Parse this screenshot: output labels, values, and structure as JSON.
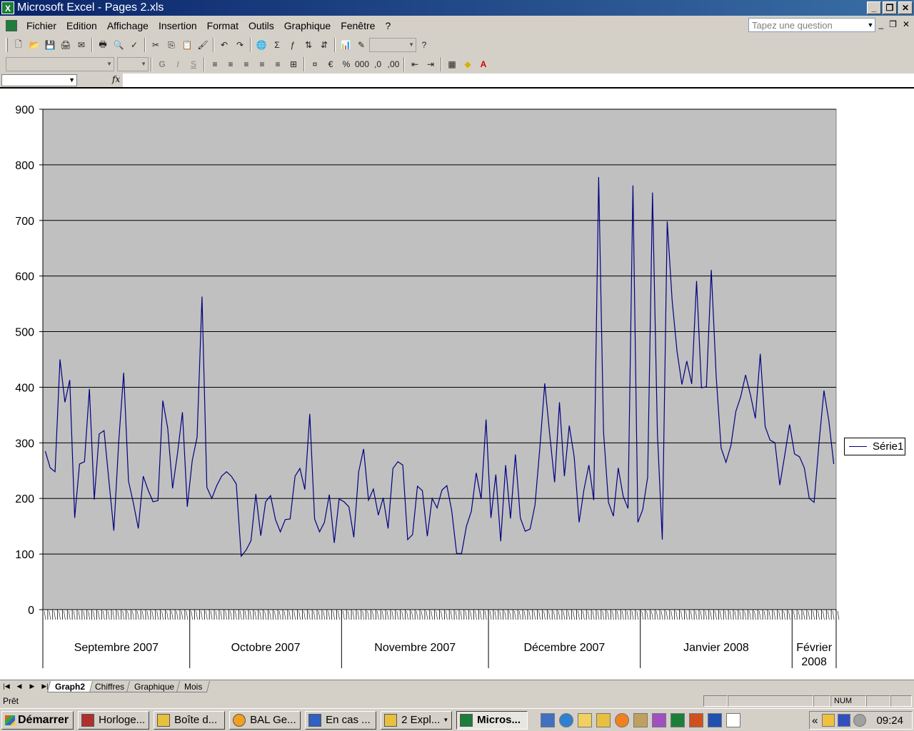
{
  "window": {
    "title": "Microsoft Excel - Pages 2.xls",
    "app_icon": "X"
  },
  "menu": [
    "Fichier",
    "Edition",
    "Affichage",
    "Insertion",
    "Format",
    "Outils",
    "Graphique",
    "Fenêtre",
    "?"
  ],
  "question_box": {
    "placeholder": "Tapez une question"
  },
  "formula": {
    "fx_label": "fx"
  },
  "chart_data": {
    "type": "line",
    "y_ticks": [
      0,
      100,
      200,
      300,
      400,
      500,
      600,
      700,
      800,
      900
    ],
    "ylim": [
      0,
      900
    ],
    "grid": true,
    "legend": "right",
    "series": [
      {
        "name": "Série1",
        "color": "#000080",
        "values": [
          285,
          255,
          248,
          450,
          373,
          413,
          165,
          262,
          266,
          397,
          198,
          316,
          322,
          231,
          142,
          303,
          426,
          231,
          191,
          146,
          240,
          215,
          194,
          196,
          376,
          326,
          218,
          281,
          355,
          185,
          268,
          310,
          563,
          220,
          200,
          223,
          240,
          248,
          240,
          226,
          96,
          107,
          124,
          208,
          133,
          194,
          205,
          162,
          140,
          162,
          163,
          240,
          254,
          216,
          352,
          163,
          140,
          157,
          207,
          120,
          199,
          194,
          185,
          130,
          248,
          289,
          197,
          217,
          170,
          201,
          146,
          254,
          266,
          260,
          126,
          135,
          222,
          214,
          132,
          200,
          183,
          215,
          223,
          178,
          101,
          101,
          150,
          177,
          246,
          199,
          342,
          165,
          243,
          123,
          260,
          164,
          279,
          165,
          141,
          145,
          188,
          292,
          407,
          316,
          229,
          373,
          240,
          331,
          275,
          157,
          216,
          260,
          197,
          778,
          320,
          193,
          168,
          255,
          204,
          182,
          763,
          157,
          180,
          238,
          750,
          315,
          126,
          698,
          556,
          465,
          405,
          447,
          406,
          591,
          399,
          401,
          611,
          419,
          291,
          265,
          295,
          356,
          383,
          422,
          386,
          344,
          460,
          329,
          305,
          300,
          224,
          278,
          333,
          280,
          275,
          255,
          200,
          193,
          300,
          394,
          340,
          262
        ]
      }
    ],
    "months": [
      "Septembre 2007",
      "Octobre 2007",
      "Novembre 2007",
      "Décembre 2007",
      "Janvier 2008",
      "Février 2008"
    ],
    "month_ranges": [
      [
        0,
        29
      ],
      [
        30,
        60
      ],
      [
        61,
        90
      ],
      [
        91,
        121
      ],
      [
        122,
        152
      ],
      [
        153,
        161
      ]
    ]
  },
  "sheets": {
    "active": "Graph2",
    "tabs": [
      "Graph2",
      "Chiffres",
      "Graphique",
      "Mois"
    ]
  },
  "status": {
    "text": "Prêt",
    "num": "NUM"
  },
  "taskbar": {
    "start_label": "Démarrer",
    "tasks": [
      {
        "label": "Horloge...",
        "color": "#b03030"
      },
      {
        "label": "Boîte d...",
        "color": "#e8c040"
      },
      {
        "label": "BAL Ge...",
        "color": "#f0a020"
      },
      {
        "label": "En cas ...",
        "color": "#3060c0"
      },
      {
        "label": "2 Expl...",
        "color": "#e8c040"
      },
      {
        "label": "Micros...",
        "color": "#1d7d3a"
      }
    ],
    "clock": "09:24",
    "tray_chevron": "«"
  }
}
